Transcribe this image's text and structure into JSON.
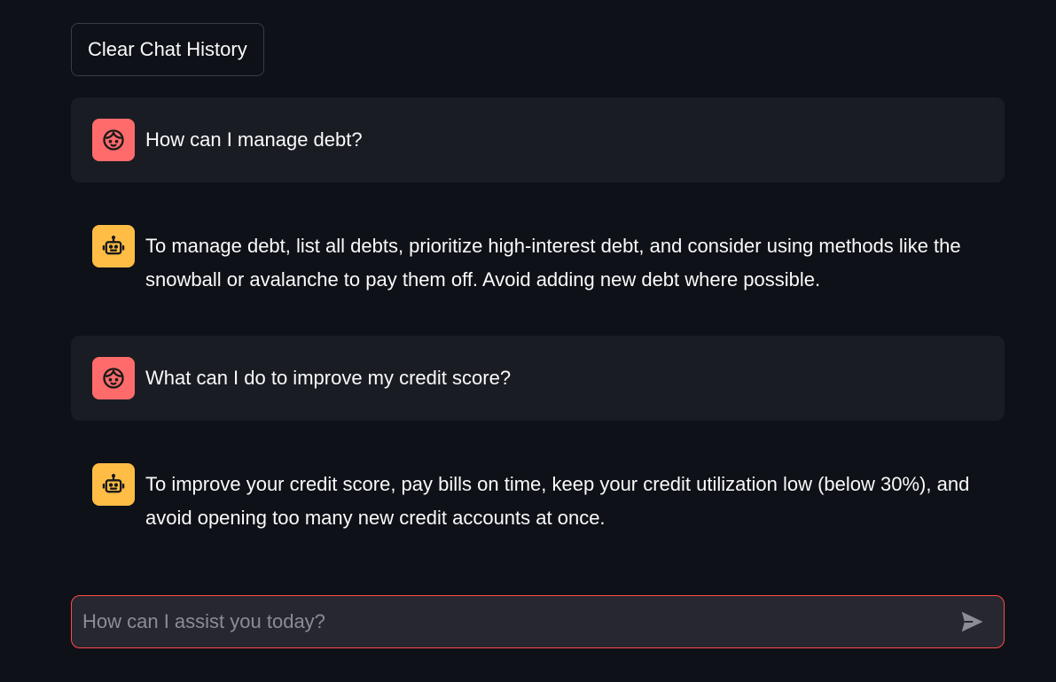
{
  "toolbar": {
    "clear_label": "Clear Chat History"
  },
  "messages": [
    {
      "role": "user",
      "avatar_icon": "user-face-icon",
      "text": "How can I manage debt?"
    },
    {
      "role": "assistant",
      "avatar_icon": "robot-icon",
      "text": "To manage debt, list all debts, prioritize high-interest debt, and consider using methods like the snowball or avalanche to pay them off. Avoid adding new debt where possible."
    },
    {
      "role": "user",
      "avatar_icon": "user-face-icon",
      "text": "What can I do to improve my credit score?"
    },
    {
      "role": "assistant",
      "avatar_icon": "robot-icon",
      "text": "To improve your credit score, pay bills on time, keep your credit utilization low (below 30%), and avoid opening too many new credit accounts at once."
    }
  ],
  "chat_input": {
    "placeholder": "How can I assist you today?",
    "value": "",
    "send_icon": "send-icon"
  },
  "colors": {
    "background": "#0e1117",
    "user_message_bg": "#1a1c24",
    "user_avatar": "#ff6b6b",
    "assistant_avatar": "#ffbd45",
    "input_border": "#ff4b4b",
    "input_bg": "#262730"
  }
}
